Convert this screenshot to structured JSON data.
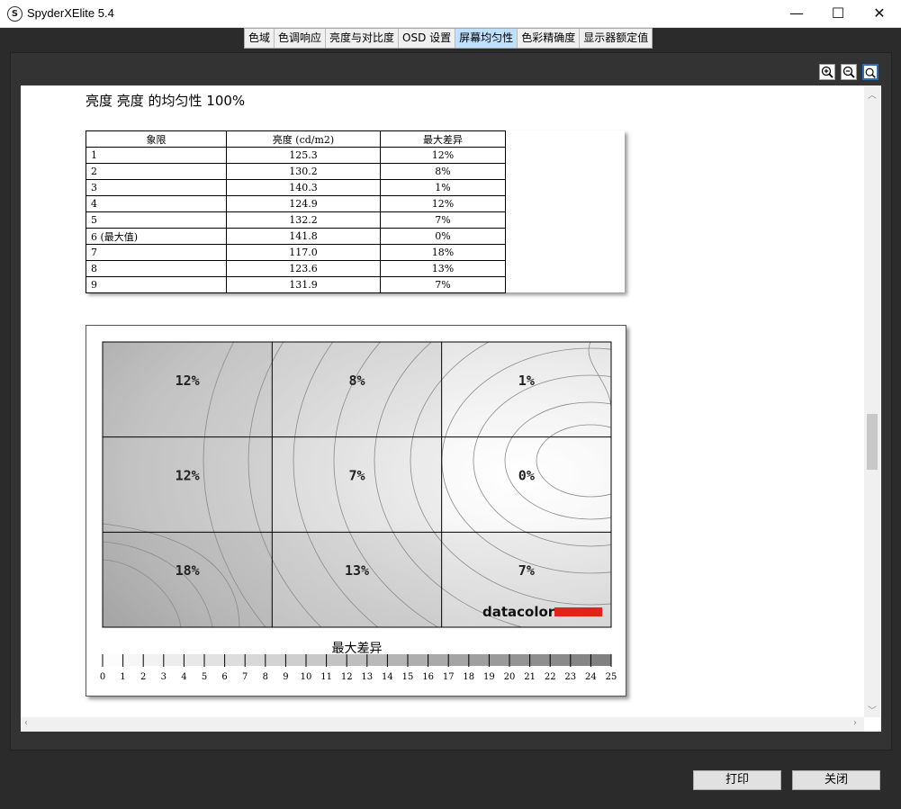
{
  "window": {
    "title": "SpyderXElite 5.4",
    "icon_letter": "S",
    "controls": {
      "minimize": "—",
      "maximize": "☐",
      "close": "✕"
    }
  },
  "tabs": [
    {
      "label": "色域"
    },
    {
      "label": "色调响应"
    },
    {
      "label": "亮度与对比度"
    },
    {
      "label": "OSD 设置"
    },
    {
      "label": "屏幕均匀性",
      "active": true
    },
    {
      "label": "色彩精确度"
    },
    {
      "label": "显示器额定值"
    }
  ],
  "zoom_tools": [
    {
      "name": "zoom-in-icon"
    },
    {
      "name": "zoom-out-icon"
    },
    {
      "name": "zoom-fit-icon",
      "active": true
    }
  ],
  "report": {
    "heading": "亮度 亮度 的均匀性 100%",
    "table": {
      "headers": [
        "象限",
        "亮度 (cd/m2)",
        "最大差异"
      ],
      "rows": [
        [
          "1",
          "125.3",
          "12%"
        ],
        [
          "2",
          "130.2",
          "8%"
        ],
        [
          "3",
          "140.3",
          "1%"
        ],
        [
          "4",
          "124.9",
          "12%"
        ],
        [
          "5",
          "132.2",
          "7%"
        ],
        [
          "6 (最大值)",
          "141.8",
          "0%"
        ],
        [
          "7",
          "117.0",
          "18%"
        ],
        [
          "8",
          "123.6",
          "13%"
        ],
        [
          "9",
          "131.9",
          "7%"
        ]
      ]
    }
  },
  "chart_data": {
    "type": "heatmap",
    "grid": {
      "rows": 3,
      "cols": 3
    },
    "cells": [
      [
        "12%",
        "8%",
        "1%"
      ],
      [
        "12%",
        "7%",
        "0%"
      ],
      [
        "18%",
        "13%",
        "7%"
      ]
    ],
    "values": [
      [
        12,
        8,
        1
      ],
      [
        12,
        7,
        0
      ],
      [
        18,
        13,
        7
      ]
    ],
    "legend_title": "最大差异",
    "scale_ticks": [
      "0",
      "1",
      "2",
      "3",
      "4",
      "5",
      "6",
      "7",
      "8",
      "9",
      "10",
      "11",
      "12",
      "13",
      "14",
      "15",
      "16",
      "17",
      "18",
      "19",
      "20",
      "21",
      "22",
      "23",
      "24",
      "25"
    ],
    "scale_range": [
      0,
      25
    ],
    "logo_text": "datacolor",
    "logo_color": "#e2231a"
  },
  "buttons": {
    "print": "打印",
    "close": "关闭"
  }
}
